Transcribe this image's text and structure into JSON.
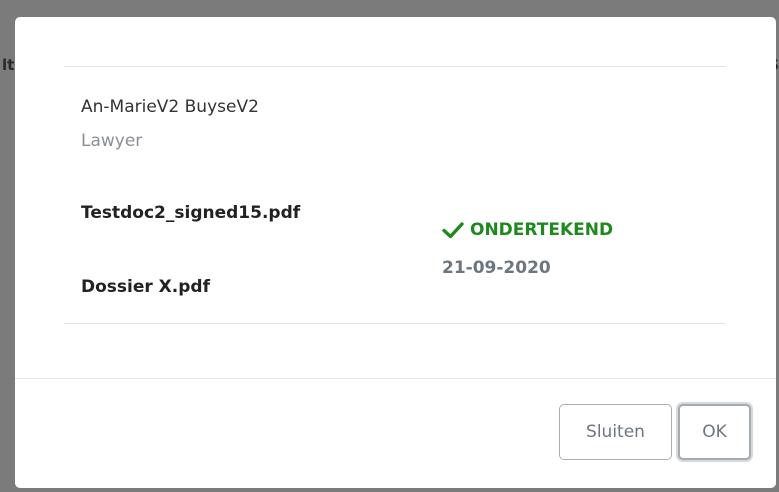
{
  "backdrop": {
    "left_fragment": "lt",
    "right_fragment": "S"
  },
  "modal": {
    "person": {
      "name": "An-MarieV2 BuyseV2",
      "role": "Lawyer"
    },
    "documents": [
      {
        "name": "Testdoc2_signed15.pdf"
      },
      {
        "name": "Dossier X.pdf"
      }
    ],
    "status": {
      "icon": "check-icon",
      "label": "ONDERTEKEND",
      "date": "21-09-2020",
      "color": "#1e8a1e"
    },
    "footer": {
      "close_label": "Sluiten",
      "ok_label": "OK"
    }
  }
}
